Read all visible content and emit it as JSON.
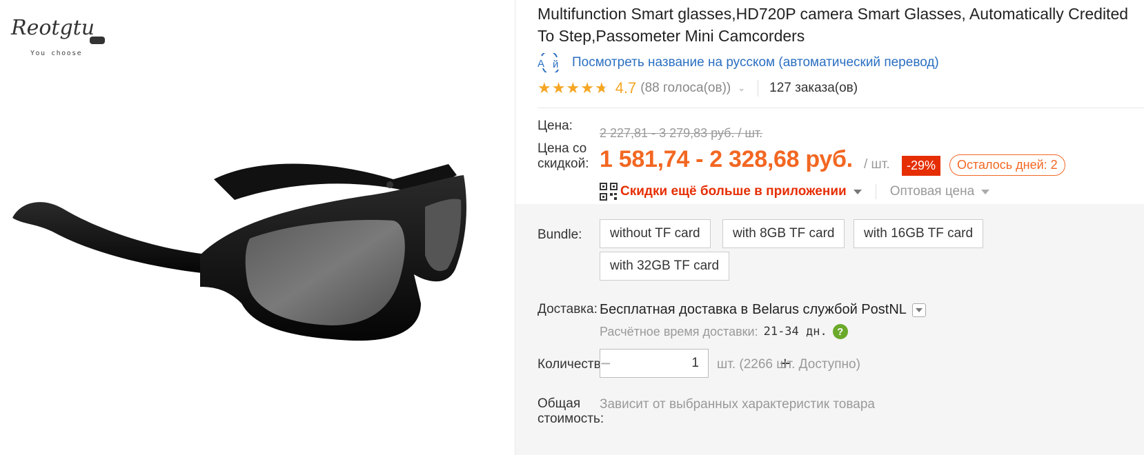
{
  "brand": {
    "logo_text": "Reotgtu",
    "logo_tagline": "You choose"
  },
  "product": {
    "title": "Multifunction Smart glasses,HD720P camera Smart Glasses, Automatically Credited To Step,Passometer Mini Camcorders",
    "translate_icon": "translate-icon",
    "translate_link": "Посмотреть название на русском (автоматический перевод)",
    "rating": "4.7",
    "votes": "(88 голоса(ов))",
    "orders": "127 заказа(ов)",
    "stars_filled": 4.7
  },
  "price": {
    "label": "Цена:",
    "old": "2 227,81 - 3 279,83 руб. / шт.",
    "discount_label": "Цена со скидкой:",
    "discount_label_line1": "Цена со",
    "discount_label_line2": "скидкой:",
    "new": "1 581,74 - 2 328,68 руб.",
    "per_unit": "/ шт.",
    "discount_badge": "-29%",
    "days_left": "Осталось дней: 2",
    "app_promo": "Скидки ещё больше в приложении",
    "wholesale": "Оптовая цена"
  },
  "bundle": {
    "label": "Bundle:",
    "options": [
      "without TF card",
      "with 8GB TF card",
      "with 16GB TF card",
      "with 32GB TF card"
    ]
  },
  "shipping": {
    "label": "Доставка:",
    "line_prefix": "Бесплатная доставка в",
    "line_rest": "Belarus службой PostNL",
    "eta_label": "Расчётное время доставки:",
    "eta_days": "21-34 дн.",
    "help": "?"
  },
  "quantity": {
    "label": "Количество:",
    "value": "1",
    "minus": "−",
    "plus": "+",
    "stock": "шт. (2266 шт. Доступно)"
  },
  "total": {
    "label_line1": "Общая",
    "label_line2": "стоимость:",
    "value": "Зависит от выбранных характеристик товара"
  },
  "colors": {
    "accent": "#f26722",
    "sale_red": "#e62e04",
    "link_blue": "#2a6fc1",
    "star": "#f5a623",
    "help_green": "#6aa92a"
  }
}
